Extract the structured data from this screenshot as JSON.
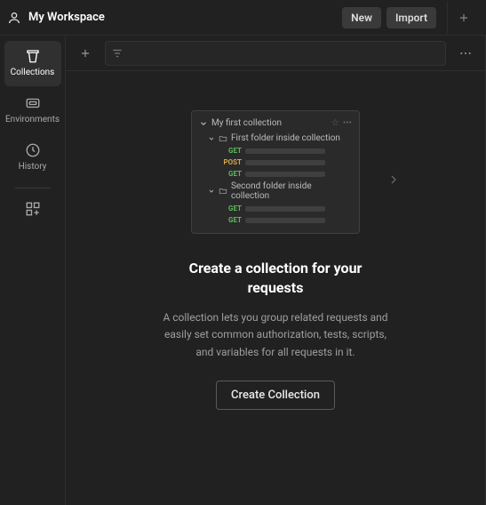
{
  "header": {
    "workspace_label": "My Workspace",
    "new_label": "New",
    "import_label": "Import"
  },
  "sidebar": {
    "items": [
      {
        "label": "Collections"
      },
      {
        "label": "Environments"
      },
      {
        "label": "History"
      }
    ]
  },
  "illustration": {
    "collection_title": "My first collection",
    "folder1": "First folder inside collection",
    "folder2": "Second folder inside collection",
    "get": "GET",
    "post": "POST"
  },
  "empty_state": {
    "title": "Create a collection for your requests",
    "body": "A collection lets you group related requests and easily set common authorization, tests, scripts, and variables for all requests in it.",
    "button_label": "Create Collection"
  }
}
